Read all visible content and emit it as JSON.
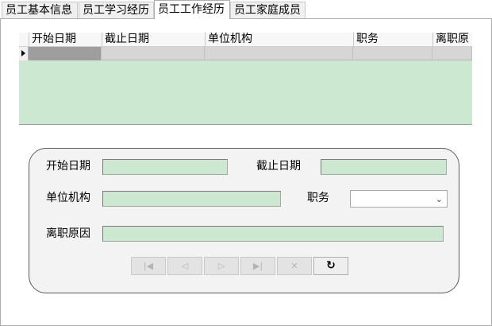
{
  "tabs": [
    {
      "label": "员工基本信息",
      "active": false
    },
    {
      "label": "员工学习经历",
      "active": false
    },
    {
      "label": "员工工作经历",
      "active": true
    },
    {
      "label": "员工家庭成员",
      "active": false
    }
  ],
  "grid": {
    "columns": [
      "开始日期",
      "截止日期",
      "单位机构",
      "职务",
      "离职原"
    ],
    "rows": [
      [
        "",
        "",
        "",
        "",
        ""
      ]
    ]
  },
  "form": {
    "start_date_label": "开始日期",
    "start_date_value": "",
    "end_date_label": "截止日期",
    "end_date_value": "",
    "org_label": "单位机构",
    "org_value": "",
    "position_label": "职务",
    "position_value": "",
    "reason_label": "离职原因",
    "reason_value": ""
  },
  "navigator": {
    "first_icon": "first-record-icon",
    "prior_icon": "prior-record-icon",
    "next_icon": "next-record-icon",
    "last_icon": "last-record-icon",
    "cancel_icon": "cancel-icon",
    "refresh_icon": "refresh-icon"
  },
  "colors": {
    "field_background": "#cde8d0",
    "panel_background": "#f3f3f3",
    "selected_cell": "#9e9e9e"
  }
}
